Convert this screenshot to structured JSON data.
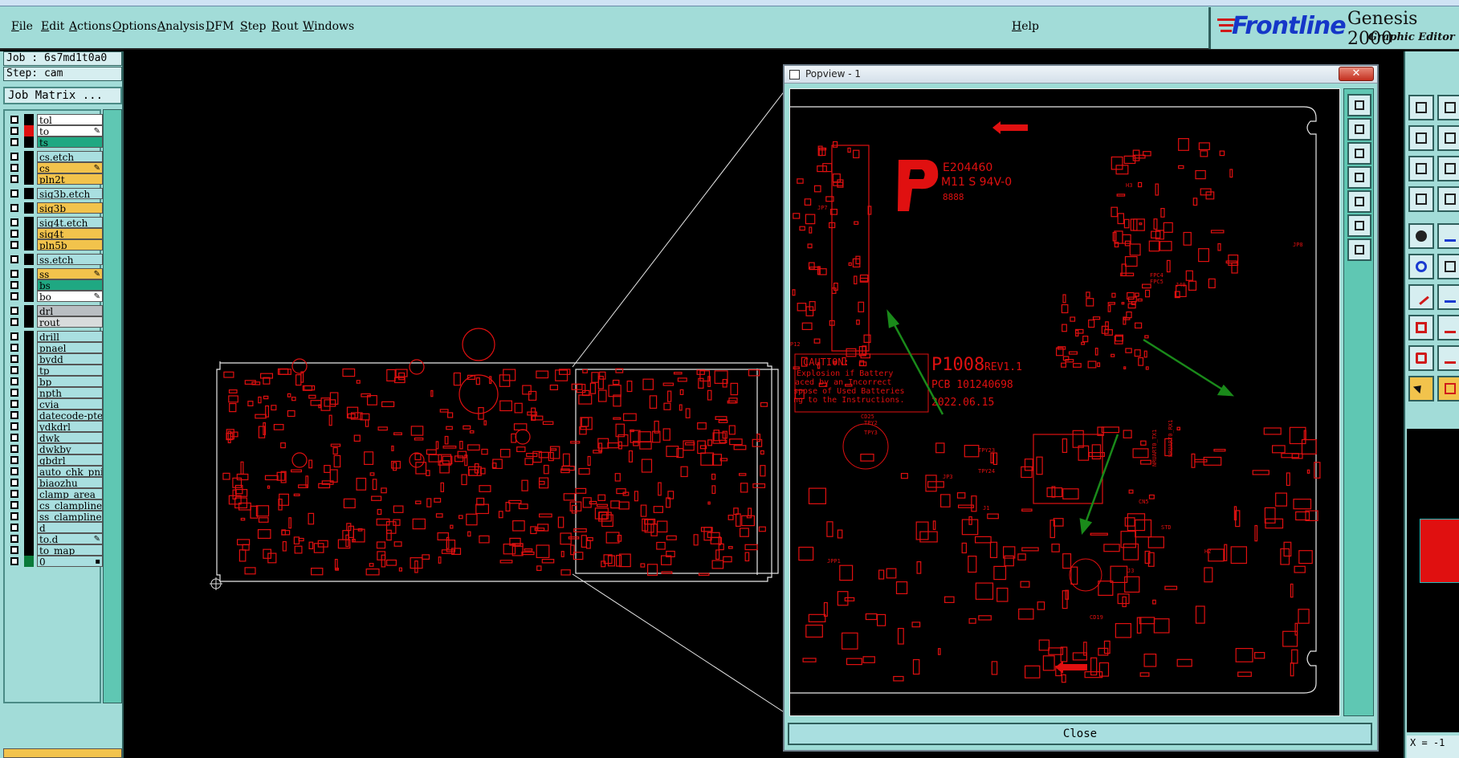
{
  "menubar": {
    "items": [
      "File",
      "Edit",
      "Actions",
      "Options",
      "Analysis",
      "DFM",
      "Step",
      "Rout",
      "Windows"
    ],
    "help": "Help"
  },
  "brand": {
    "logo": "Frontline",
    "product": "Genesis 2000",
    "subtitle": "Graphic Editor"
  },
  "job": {
    "job_label": "Job : 6s7md1t0a0",
    "step_label": "Step: cam",
    "matrix_button": "Job Matrix ..."
  },
  "layers": [
    {
      "name": "tol",
      "color": "#ffffff",
      "swatch": "#000000",
      "marker": ""
    },
    {
      "name": "to",
      "color": "#ffffff",
      "swatch": "#e01010",
      "marker": "✎"
    },
    {
      "name": "ts",
      "color": "#1fa882",
      "swatch": "#000000",
      "marker": ""
    },
    {
      "name": "cs.etch",
      "color": "#a9dfe0",
      "swatch": "#000000",
      "marker": ""
    },
    {
      "name": "cs",
      "color": "#f2c34c",
      "swatch": "#000000",
      "marker": "✎"
    },
    {
      "name": "pln2t",
      "color": "#f2c34c",
      "swatch": "#000000",
      "marker": ""
    },
    {
      "name": "sig3b.etch",
      "color": "#a9dfe0",
      "swatch": "#000000",
      "marker": ""
    },
    {
      "name": "sig3b",
      "color": "#f2c34c",
      "swatch": "#000000",
      "marker": ""
    },
    {
      "name": "sig4t.etch",
      "color": "#a9dfe0",
      "swatch": "#000000",
      "marker": ""
    },
    {
      "name": "sig4t",
      "color": "#f2c34c",
      "swatch": "#000000",
      "marker": ""
    },
    {
      "name": "pln5b",
      "color": "#f2c34c",
      "swatch": "#000000",
      "marker": ""
    },
    {
      "name": "ss.etch",
      "color": "#a9dfe0",
      "swatch": "#000000",
      "marker": ""
    },
    {
      "name": "ss",
      "color": "#f2c34c",
      "swatch": "#000000",
      "marker": "✎"
    },
    {
      "name": "bs",
      "color": "#1fa882",
      "swatch": "#000000",
      "marker": ""
    },
    {
      "name": "bo",
      "color": "#ffffff",
      "swatch": "#000000",
      "marker": "✎"
    },
    {
      "name": "drl",
      "color": "#b9bec2",
      "swatch": "#000000",
      "marker": ""
    },
    {
      "name": "rout",
      "color": "#d8dbdc",
      "swatch": "#000000",
      "marker": ""
    },
    {
      "name": "drill",
      "color": "#a9dfe0",
      "swatch": "#000000",
      "marker": ""
    },
    {
      "name": "pnael",
      "color": "#a9dfe0",
      "swatch": "#000000",
      "marker": ""
    },
    {
      "name": "bydd",
      "color": "#a9dfe0",
      "swatch": "#000000",
      "marker": ""
    },
    {
      "name": "tp",
      "color": "#a9dfe0",
      "swatch": "#000000",
      "marker": ""
    },
    {
      "name": "bp",
      "color": "#a9dfe0",
      "swatch": "#000000",
      "marker": ""
    },
    {
      "name": "npth",
      "color": "#a9dfe0",
      "swatch": "#000000",
      "marker": ""
    },
    {
      "name": "cvia",
      "color": "#a9dfe0",
      "swatch": "#000000",
      "marker": ""
    },
    {
      "name": "datecode-pte",
      "color": "#a9dfe0",
      "swatch": "#000000",
      "marker": ""
    },
    {
      "name": "ydkdrl",
      "color": "#a9dfe0",
      "swatch": "#000000",
      "marker": ""
    },
    {
      "name": "dwk",
      "color": "#a9dfe0",
      "swatch": "#000000",
      "marker": ""
    },
    {
      "name": "dwkby",
      "color": "#a9dfe0",
      "swatch": "#000000",
      "marker": ""
    },
    {
      "name": "gbdrl",
      "color": "#a9dfe0",
      "swatch": "#000000",
      "marker": ""
    },
    {
      "name": "auto_chk_pni",
      "color": "#a9dfe0",
      "swatch": "#000000",
      "marker": ""
    },
    {
      "name": "biaozhu",
      "color": "#a9dfe0",
      "swatch": "#000000",
      "marker": ""
    },
    {
      "name": "clamp_area",
      "color": "#a9dfe0",
      "swatch": "#000000",
      "marker": ""
    },
    {
      "name": "cs_clampline",
      "color": "#a9dfe0",
      "swatch": "#000000",
      "marker": ""
    },
    {
      "name": "ss_clampline",
      "color": "#a9dfe0",
      "swatch": "#000000",
      "marker": ""
    },
    {
      "name": "d",
      "color": "#a9dfe0",
      "swatch": "#000000",
      "marker": ""
    },
    {
      "name": "to.d",
      "color": "#a9dfe0",
      "swatch": "#000000",
      "marker": "✎"
    },
    {
      "name": "to_map",
      "color": "#a9dfe0",
      "swatch": "#000000",
      "marker": ""
    },
    {
      "name": "0",
      "color": "#a9dfe0",
      "swatch": "#0a7a3a",
      "marker": "▪"
    }
  ],
  "popview": {
    "title": "Popview - 1",
    "close_x": "✕",
    "close_button": "Close",
    "board_texts": {
      "ul_code": "E204460",
      "ul_rating": "M11 S 94V-0",
      "date_code": "8888",
      "part_no": "P1008",
      "rev": "REV1.1",
      "pcb_no": "PCB 101240698",
      "date": "2022.06.15",
      "caution_title": "CAUTION:",
      "caution_lines": [
        "Explosion if Battery",
        "aced by an Incorrect",
        "spose of Used Batteries",
        "ng to the Instructions."
      ],
      "refs": [
        "JP7",
        "P12",
        "H3",
        "JP8",
        "FPC4",
        "FPC5",
        "J40",
        "TPY2",
        "TPY3",
        "TPY23",
        "TPY24",
        "JP3",
        "JPP1",
        "CD25",
        "CD19",
        "J3",
        "STD",
        "H2",
        "NRUART0_TX1",
        "NRUART0_RX1",
        "CN5",
        "J1"
      ]
    }
  },
  "status": {
    "coord": "X = -1"
  }
}
